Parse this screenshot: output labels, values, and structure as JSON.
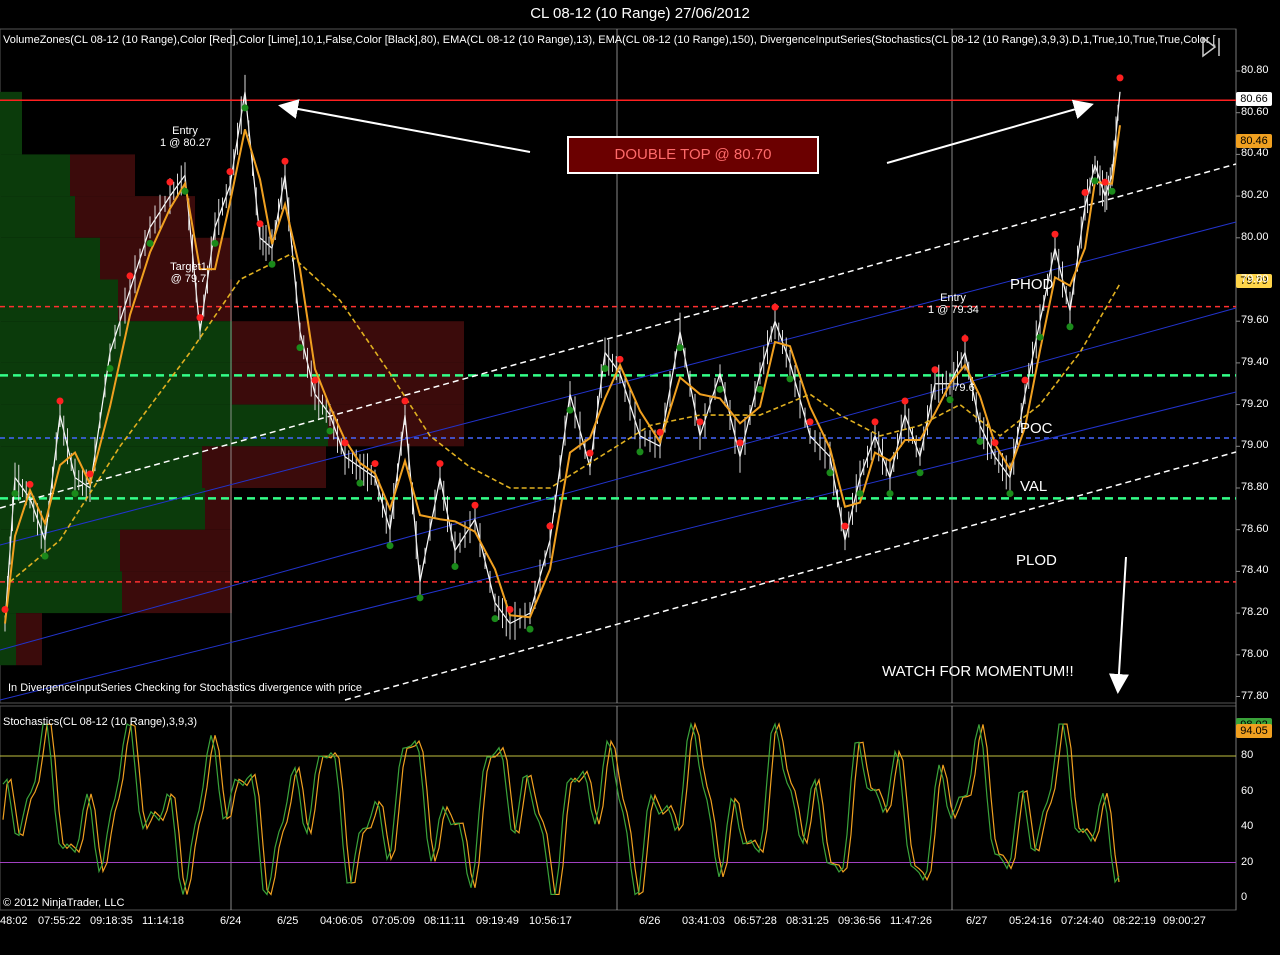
{
  "window": {
    "title": "CL 08-12 (10 Range)  27/06/2012"
  },
  "price_panel": {
    "indicators_text": "VolumeZones(CL 08-12 (10 Range),Color [Red],Color [Lime],10,1,False,Color [Black],80), EMA(CL 08-12 (10 Range),13), EMA(CL 08-12 (10 Range),150), DivergenceInputSeries(Stochastics(CL 08-12 (10 Range),3,9,3).D,1,True,10,True,True,Color [",
    "status_text": "In DivergenceInputSeries Checking for Stochastics  divergence with price",
    "last_price": "80.66",
    "tag_ema13": "80.46",
    "tag_ema150": "79.79",
    "y_ticks": [
      "80.80",
      "80.60",
      "80.40",
      "80.20",
      "80.00",
      "79.80",
      "79.60",
      "79.40",
      "79.20",
      "79.00",
      "78.80",
      "78.60",
      "78.40",
      "78.20",
      "78.00",
      "77.80"
    ],
    "annotations": {
      "double_top": "DOUBLE TOP @ 80.70",
      "phod": "PHOD",
      "poc": "POC",
      "val": "VAL",
      "plod": "PLOD",
      "watch": "WATCH FOR MOMENTUM!!",
      "entry1_title": "Entry",
      "entry1_detail": "1 @ 80.27",
      "target1": "Target1",
      "target1_detail": "@ 79.7",
      "entry2_title": "Entry",
      "entry2_detail": "1 @ 79.34",
      "stop_detail": "79.6"
    },
    "levels_color": {
      "double_top": "#ff2020",
      "phod": "#ff3030",
      "plod": "#ff3030",
      "vah": "#33ff88",
      "val": "#33ff88",
      "poc": "#4466ff"
    }
  },
  "stoch_panel": {
    "title": "Stochastics(CL 08-12 (10 Range),3,9,3)",
    "y_ticks": [
      "80",
      "60",
      "40",
      "20",
      "0"
    ],
    "tag_k": "98.02",
    "tag_d": "94.05"
  },
  "time_axis": [
    "48:02",
    "07:55:22",
    "09:18:35",
    "11:14:18",
    "6/24",
    "6/25",
    "04:06:05",
    "07:05:09",
    "08:11:11",
    "09:19:49",
    "10:56:17",
    "6/26",
    "03:41:03",
    "06:57:28",
    "08:31:25",
    "09:36:56",
    "11:47:26",
    "6/27",
    "05:24:16",
    "07:24:40",
    "08:22:19",
    "09:00:27"
  ],
  "copyright": "© 2012 NinjaTrader, LLC"
}
